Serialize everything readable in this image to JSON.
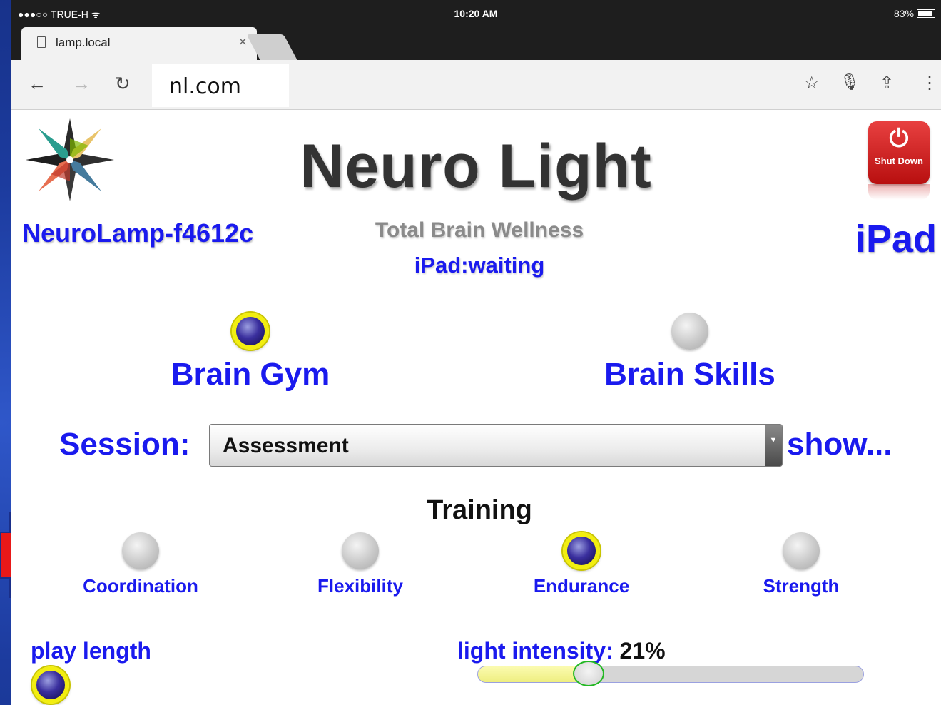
{
  "status_bar": {
    "carrier": "●●●○○ TRUE-H ᯤ",
    "time": "10:20 AM",
    "battery": "83%"
  },
  "tab": {
    "title": "lamp.local",
    "close": "×"
  },
  "toolbar": {
    "url": "nl.com",
    "back_icon": "←",
    "forward_icon": "→",
    "reload_icon": "↻",
    "star_icon": "☆",
    "mic_icon": "🎙",
    "share_icon": "⇪",
    "menu_icon": "⋮"
  },
  "header": {
    "app_title": "Neuro Light",
    "subtitle": "Total Brain Wellness",
    "status": "iPad:waiting",
    "lamp_name": "NeuroLamp-f4612c",
    "device": "iPad",
    "shutdown_label": "Shut Down",
    "shutdown_icon": "⏻"
  },
  "modes": [
    {
      "label": "Brain Gym",
      "selected": true
    },
    {
      "label": "Brain Skills",
      "selected": false
    }
  ],
  "session": {
    "label": "Session:",
    "selected": "Assessment",
    "show_link": "show..."
  },
  "training": {
    "title": "Training",
    "options": [
      {
        "label": "Coordination",
        "selected": false
      },
      {
        "label": "Flexibility",
        "selected": false
      },
      {
        "label": "Endurance",
        "selected": true
      },
      {
        "label": "Strength",
        "selected": false
      }
    ]
  },
  "play_length": {
    "label": "play length",
    "selected": true
  },
  "light_intensity": {
    "label": "light intensity:",
    "value_text": "21%",
    "value": 0.21
  },
  "colors": {
    "accent_blue": "#1a1aee",
    "selected_ring": "#f2ee10",
    "shutdown_red": "#c81d1d",
    "slider_thumb_border": "#22b822"
  }
}
